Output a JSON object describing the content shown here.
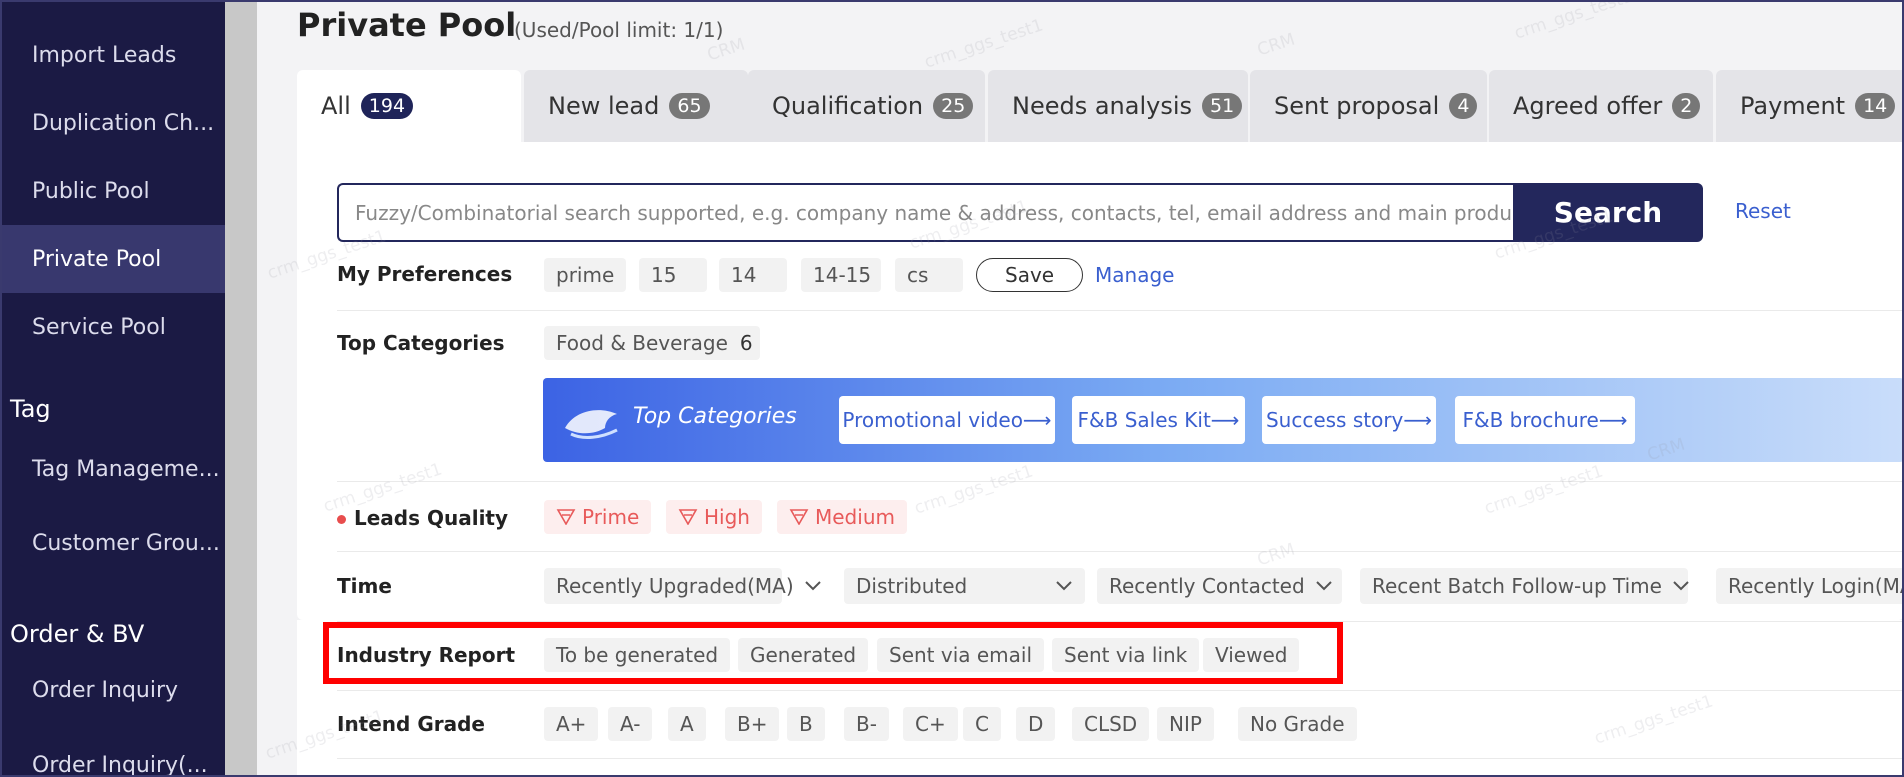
{
  "sidebar": {
    "items": [
      {
        "label": "Import Leads"
      },
      {
        "label": "Duplication Ch..."
      },
      {
        "label": "Public Pool"
      },
      {
        "label": "Private Pool"
      },
      {
        "label": "Service Pool"
      },
      {
        "label": "Tag Manageme..."
      },
      {
        "label": "Customer Grou..."
      },
      {
        "label": "Order Inquiry"
      },
      {
        "label": "Order Inquiry(..."
      }
    ],
    "active_item": "Private Pool",
    "sections": {
      "tag": "Tag",
      "order": "Order & BV"
    }
  },
  "header": {
    "title": "Private Pool",
    "subtitle": "(Used/Pool limit:  1/1)"
  },
  "tabs": [
    {
      "label": "All",
      "count": "194"
    },
    {
      "label": "New lead",
      "count": "65"
    },
    {
      "label": "Qualification",
      "count": "25"
    },
    {
      "label": "Needs analysis",
      "count": "51"
    },
    {
      "label": "Sent proposal",
      "count": "4"
    },
    {
      "label": "Agreed offer",
      "count": "2"
    },
    {
      "label": "Payment",
      "count": "14"
    }
  ],
  "search": {
    "placeholder": "Fuzzy/Combinatorial search supported, e.g. company name & address, contacts, tel, email address and main products.",
    "button": "Search",
    "reset": "Reset"
  },
  "preferences": {
    "label": "My Preferences",
    "chips": [
      "prime",
      "15",
      "14",
      "14-15",
      "cs"
    ],
    "save": "Save",
    "manage": "Manage"
  },
  "top_categories": {
    "label": "Top Categories",
    "chip": "Food & Beverage",
    "chip_count": "6",
    "banner_title": "Top Categories",
    "banner_buttons": [
      "Promotional video⟶",
      "F&B Sales Kit⟶",
      "Success story⟶",
      "F&B brochure⟶"
    ]
  },
  "leads_quality": {
    "label": "Leads Quality",
    "chips": [
      "Prime",
      "High",
      "Medium"
    ]
  },
  "time": {
    "label": "Time",
    "dropdowns": [
      "Recently Upgraded(MA)",
      "Distributed",
      "Recently Contacted",
      "Recent Batch Follow-up Time",
      "Recently Login(MA"
    ]
  },
  "industry_report": {
    "label": "Industry Report",
    "chips": [
      "To be generated",
      "Generated",
      "Sent via email",
      "Sent via link",
      "Viewed"
    ]
  },
  "intend_grade": {
    "label": "Intend Grade",
    "chips": [
      "A+",
      "A-",
      "A",
      "B+",
      "B",
      "B-",
      "C+",
      "C",
      "D",
      "CLSD",
      "NIP",
      "No Grade"
    ]
  },
  "watermarks": [
    "crm_ggs_test1",
    "CRM"
  ],
  "colors": {
    "sidebar_bg": "#1b1a44",
    "sidebar_active": "#38386e",
    "primary": "#23275c",
    "link": "#3a5fcf",
    "quality": "#e85a5a",
    "highlight": "#ff0000"
  }
}
